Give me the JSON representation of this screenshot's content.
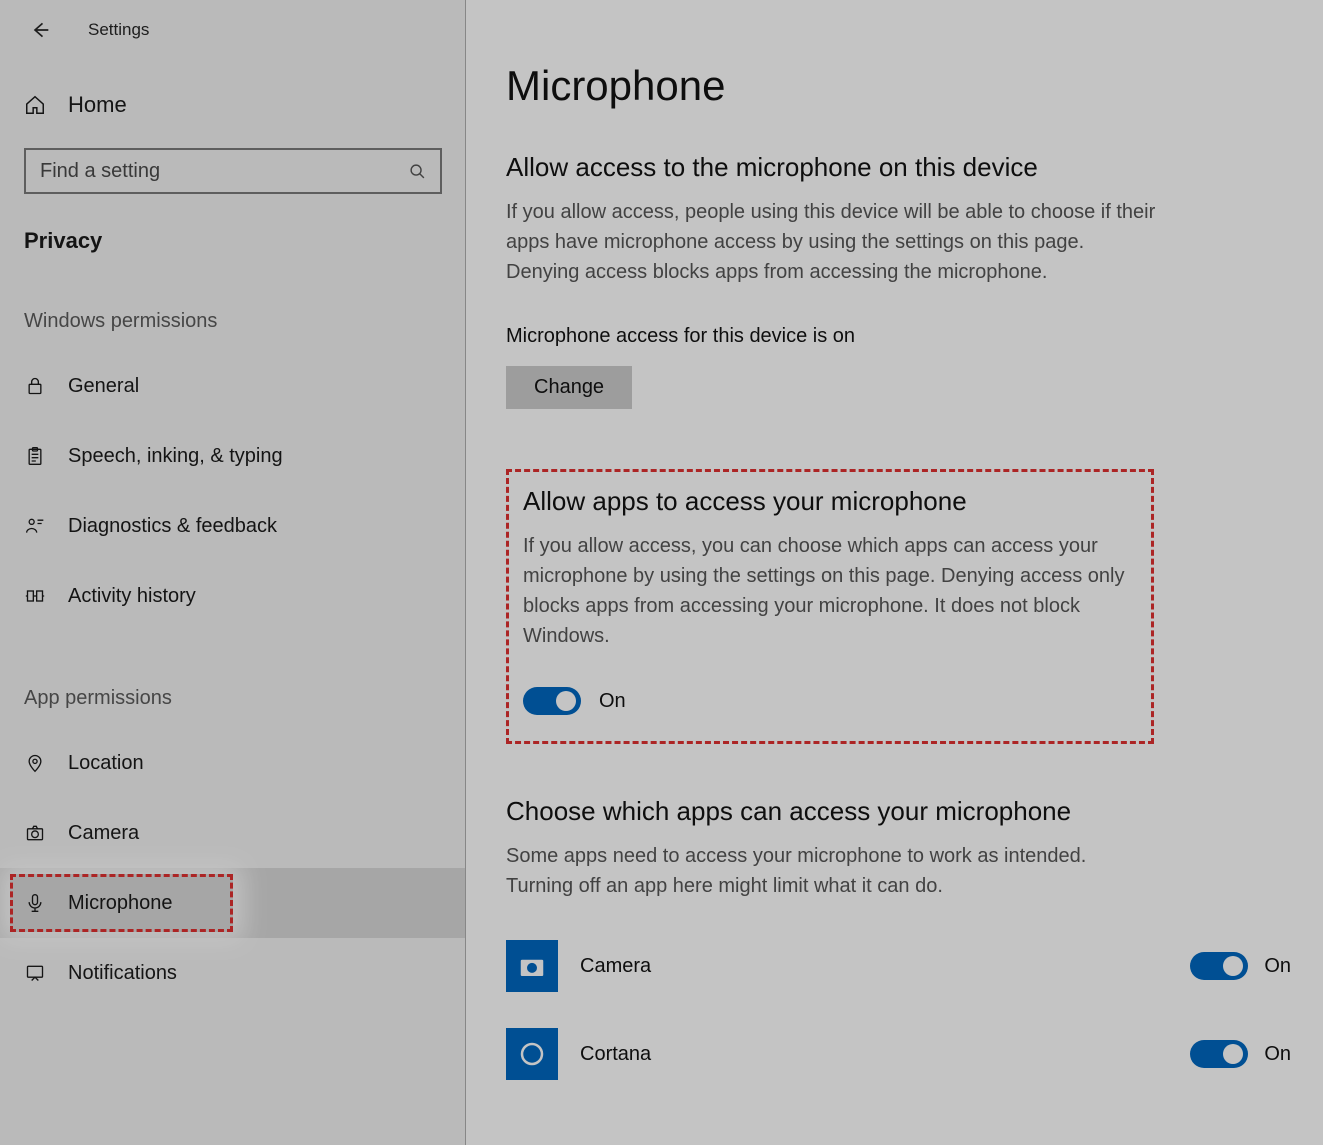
{
  "header": {
    "back": "←",
    "title": "Settings"
  },
  "home": {
    "label": "Home"
  },
  "search": {
    "placeholder": "Find a setting"
  },
  "category": "Privacy",
  "nav": {
    "group1_title": "Windows permissions",
    "group1": [
      {
        "label": "General"
      },
      {
        "label": "Speech, inking, & typing"
      },
      {
        "label": "Diagnostics & feedback"
      },
      {
        "label": "Activity history"
      }
    ],
    "group2_title": "App permissions",
    "group2": [
      {
        "label": "Location"
      },
      {
        "label": "Camera"
      },
      {
        "label": "Microphone"
      },
      {
        "label": "Notifications"
      }
    ]
  },
  "main": {
    "title": "Microphone",
    "section1": {
      "heading": "Allow access to the microphone on this device",
      "desc": "If you allow access, people using this device will be able to choose if their apps have microphone access by using the settings on this page. Denying access blocks apps from accessing the microphone.",
      "status": "Microphone access for this device is on",
      "change": "Change"
    },
    "section2": {
      "heading": "Allow apps to access your microphone",
      "desc": "If you allow access, you can choose which apps can access your microphone by using the settings on this page. Denying access only blocks apps from accessing your microphone. It does not block Windows.",
      "toggle_label": "On"
    },
    "section3": {
      "heading": "Choose which apps can access your microphone",
      "desc": "Some apps need to access your microphone to work as intended. Turning off an app here might limit what it can do.",
      "apps": [
        {
          "name": "Camera",
          "state": "On"
        },
        {
          "name": "Cortana",
          "state": "On"
        }
      ]
    }
  }
}
